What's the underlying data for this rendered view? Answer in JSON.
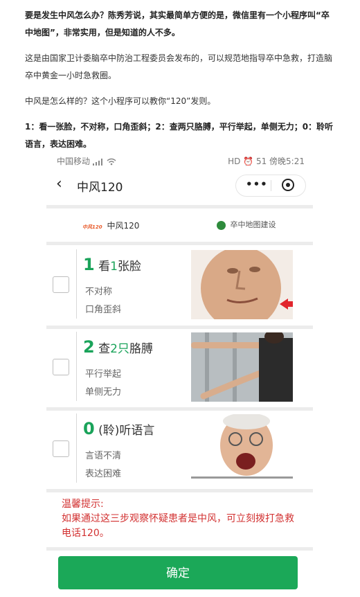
{
  "article": {
    "p1": "要是发生中风怎么办？陈秀芳说，其实最简单方便的是，微信里有一个小程序叫“卒中地图”，非常实用，但是知道的人不多。",
    "p2": "这是由国家卫计委脑卒中防治工程委员会发布的，可以规范地指导卒中急救，打造脑卒中黄金一小时急救圈。",
    "p3": "中风是怎么样的？这个小程序可以教你“120”发则。",
    "p4": "1：看一张脸，不对称，口角歪斜；2：查两只胳膊，平行举起，单侧无力；0：聆听语言，表达困难。"
  },
  "status_bar": {
    "carrier": "中国移动",
    "signal_icon": "signal-icon",
    "wifi_icon": "wifi-icon",
    "right": "HD ⏰ 51 傍晚5:21"
  },
  "navbar": {
    "back": "‹",
    "title": "中风120",
    "more": "•••"
  },
  "brand": {
    "left_logo": "中风120",
    "left_text": "中风120",
    "right_text": "卒中地图建设"
  },
  "steps": [
    {
      "num": "1",
      "pre": "看",
      "mid": "1",
      "post": "张脸",
      "line1": "不对称",
      "line2": "口角歪斜"
    },
    {
      "num": "2",
      "pre": "查",
      "mid": "2只",
      "post": "胳膊",
      "line1": "平行举起",
      "line2": "单侧无力"
    },
    {
      "num": "0",
      "pre": "",
      "mid": "",
      "post": "(聆)听语言",
      "line1": "言语不清",
      "line2": "表达困难"
    }
  ],
  "tip": {
    "title": "温馨提示:",
    "body": "如果通过这三步观察怀疑患者是中风，可立刻拨打急救电话120。"
  },
  "confirm_label": "确定",
  "colors": {
    "accent": "#1aa35a",
    "tip": "#d23030",
    "button": "#1ba858"
  }
}
